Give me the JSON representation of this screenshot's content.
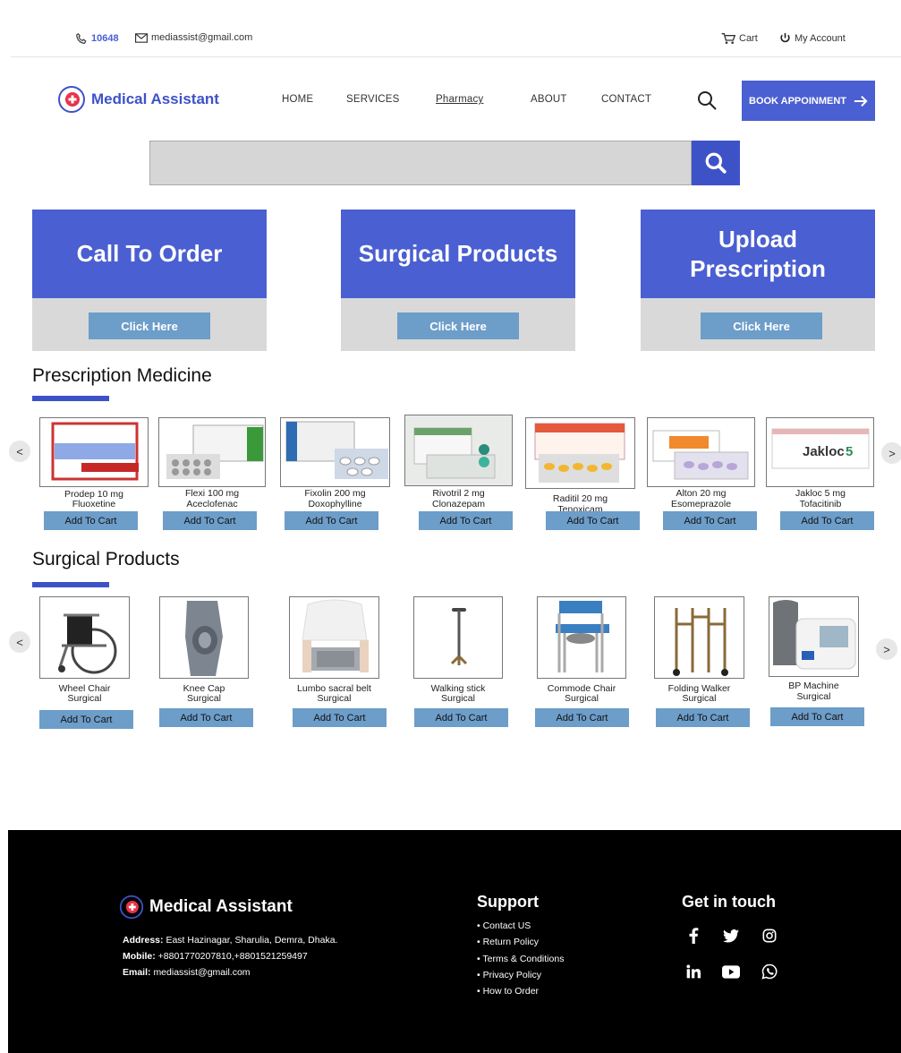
{
  "topbar": {
    "hotline": "10648",
    "email": "mediassist@gmail.com",
    "cart_label": "Cart",
    "account_label": "My Account"
  },
  "header": {
    "brand": "Medical Assistant",
    "nav": [
      "HOME",
      "SERVICES",
      "Pharmacy",
      "ABOUT",
      "CONTACT"
    ],
    "active_nav": "Pharmacy",
    "book_label": "BOOK APPOINMENT"
  },
  "search": {
    "placeholder": ""
  },
  "promo_cards": [
    {
      "title": "Call To Order",
      "button": "Click Here"
    },
    {
      "title": "Surgical Products",
      "button": "Click Here"
    },
    {
      "title": "Upload Prescription",
      "button": "Click Here"
    }
  ],
  "prescription": {
    "title": "Prescription Medicine",
    "prev": "<",
    "next": ">",
    "items": [
      {
        "name": "Prodep 10 mg",
        "generic": "Fluoxetine",
        "cart": "Add To Cart"
      },
      {
        "name": "Flexi 100 mg",
        "generic": "Aceclofenac",
        "cart": "Add To Cart"
      },
      {
        "name": "Fixolin 200 mg",
        "generic": "Doxophylline",
        "cart": "Add To Cart"
      },
      {
        "name": "Rivotril 2 mg",
        "generic": "Clonazepam",
        "cart": "Add To Cart"
      },
      {
        "name": "Raditil 20 mg",
        "generic": "Tenoxicam",
        "cart": "Add To Cart"
      },
      {
        "name": "Alton 20 mg",
        "generic": "Esomeprazole",
        "cart": "Add To Cart"
      },
      {
        "name": "Jakloc 5 mg",
        "generic": "Tofacitinib",
        "cart": "Add To Cart"
      }
    ]
  },
  "surgical": {
    "title": "Surgical Products",
    "prev": "<",
    "next": ">",
    "items": [
      {
        "name": "Wheel Chair",
        "generic": "Surgical",
        "cart": "Add To Cart"
      },
      {
        "name": "Knee Cap",
        "generic": "Surgical",
        "cart": "Add To Cart"
      },
      {
        "name": "Lumbo sacral belt",
        "generic": "Surgical",
        "cart": "Add To Cart"
      },
      {
        "name": "Walking stick",
        "generic": "Surgical",
        "cart": "Add To Cart"
      },
      {
        "name": "Commode Chair",
        "generic": "Surgical",
        "cart": "Add To Cart"
      },
      {
        "name": "Folding Walker",
        "generic": "Surgical",
        "cart": "Add To Cart"
      },
      {
        "name": "BP Machine",
        "generic": "Surgical",
        "cart": "Add To Cart"
      }
    ]
  },
  "footer": {
    "brand": "Medical Assistant",
    "address_label": "Address:",
    "address": "East Hazinagar, Sharulia, Demra, Dhaka.",
    "mobile_label": "Mobile:",
    "mobile": "+8801770207810,+8801521259497",
    "email_label": "Email:",
    "email": "mediassist@gmail.com",
    "support_title": "Support",
    "support_links": [
      "Contact US",
      "Return Policy",
      "Terms & Conditions",
      "Privacy Policy",
      "How to Order"
    ],
    "touch_title": "Get in touch",
    "social_icons": [
      "facebook-icon",
      "twitter-icon",
      "instagram-icon",
      "linkedin-icon",
      "youtube-icon",
      "whatsapp-icon"
    ]
  },
  "colors": {
    "primary": "#4a5fd1",
    "button_blue": "#6d9dc9",
    "card_gray": "#d9d9d9",
    "footer_bg": "#000000"
  }
}
